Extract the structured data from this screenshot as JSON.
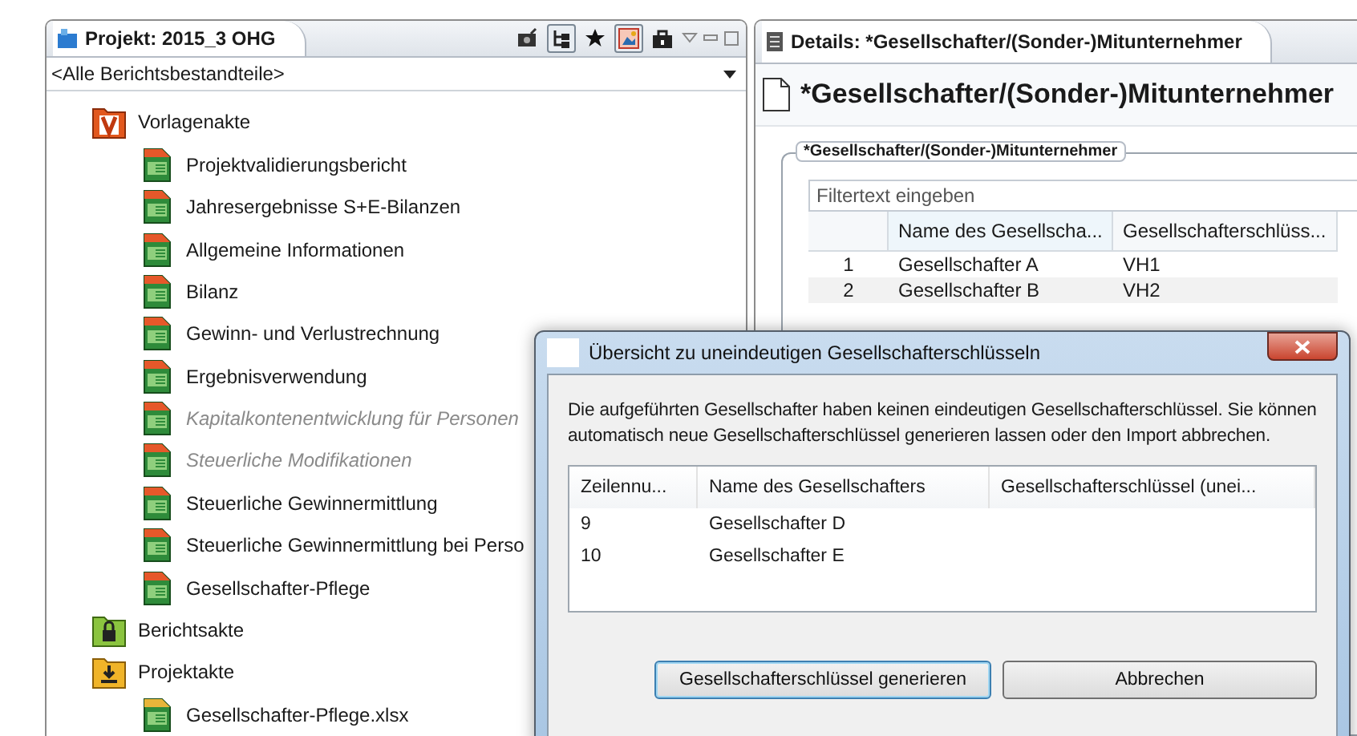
{
  "project_panel": {
    "title": "Projekt: 2015_3 OHG",
    "toolbar": [
      {
        "kind": "camera",
        "pressed": false
      },
      {
        "kind": "tree",
        "pressed": true
      },
      {
        "kind": "star",
        "pressed": false
      },
      {
        "kind": "picture",
        "pressed": true
      },
      {
        "kind": "lock",
        "pressed": false
      }
    ],
    "filter": {
      "value": "<Alle Berichtsbestandteile>"
    },
    "tree": [
      {
        "label": "Vorlagenakte",
        "kind": "template-folder",
        "disabled": false,
        "children": [
          {
            "label": "Projektvalidierungsbericht",
            "kind": "document",
            "disabled": false
          },
          {
            "label": "Jahresergebnisse S+E-Bilanzen",
            "kind": "document",
            "disabled": false
          },
          {
            "label": "Allgemeine Informationen",
            "kind": "document",
            "disabled": false
          },
          {
            "label": "Bilanz",
            "kind": "document",
            "disabled": false
          },
          {
            "label": "Gewinn- und Verlustrechnung",
            "kind": "document",
            "disabled": false
          },
          {
            "label": "Ergebnisverwendung",
            "kind": "document",
            "disabled": false
          },
          {
            "label": "Kapitalkontenentwicklung für Personen",
            "kind": "document",
            "disabled": true
          },
          {
            "label": "Steuerliche Modifikationen",
            "kind": "document",
            "disabled": true
          },
          {
            "label": "Steuerliche Gewinnermittlung",
            "kind": "document",
            "disabled": false
          },
          {
            "label": "Steuerliche Gewinnermittlung bei Perso",
            "kind": "document",
            "disabled": false
          },
          {
            "label": "Gesellschafter-Pflege",
            "kind": "document",
            "disabled": false
          }
        ]
      },
      {
        "label": "Berichtsakte",
        "kind": "locked-folder",
        "disabled": false
      },
      {
        "label": "Projektakte",
        "kind": "download-folder",
        "disabled": false,
        "children": [
          {
            "label": "Gesellschafter-Pflege.xlsx",
            "kind": "spreadsheet",
            "disabled": false
          }
        ]
      }
    ]
  },
  "details_panel": {
    "title": "Details: *Gesellschafter/(Sonder-)Mitunternehmer",
    "heading": "*Gesellschafter/(Sonder-)Mitunternehmer",
    "group_title": "*Gesellschafter/(Sonder-)Mitunternehmer",
    "filter": {
      "placeholder": "Filtertext eingeben"
    },
    "table": {
      "columns": [
        "Name des Gesellscha...",
        "Gesellschafterschlüss..."
      ],
      "rows": [
        {
          "number": "1",
          "cells": [
            "Gesellschafter A",
            "VH1"
          ]
        },
        {
          "number": "2",
          "cells": [
            "Gesellschafter B",
            "VH2"
          ]
        }
      ]
    }
  },
  "dialog": {
    "title": "Übersicht zu uneindeutigen Gesellschafterschlüsseln",
    "message": "Die aufgeführten Gesellschafter haben keinen eindeutigen Gesellschafterschlüssel. Sie können automatisch neue Gesellschafterschlüssel generieren lassen oder den Import abbrechen.",
    "table": {
      "columns": [
        "Zeilennu...",
        "Name des Gesellschafters",
        "Gesellschafterschlüssel (unei..."
      ],
      "rows": [
        [
          "9",
          "Gesellschafter D",
          ""
        ],
        [
          "10",
          "Gesellschafter E",
          ""
        ]
      ]
    },
    "buttons": [
      {
        "label": "Gesellschafterschlüssel generieren",
        "default": true
      },
      {
        "label": "Abbrechen",
        "default": false
      }
    ]
  }
}
